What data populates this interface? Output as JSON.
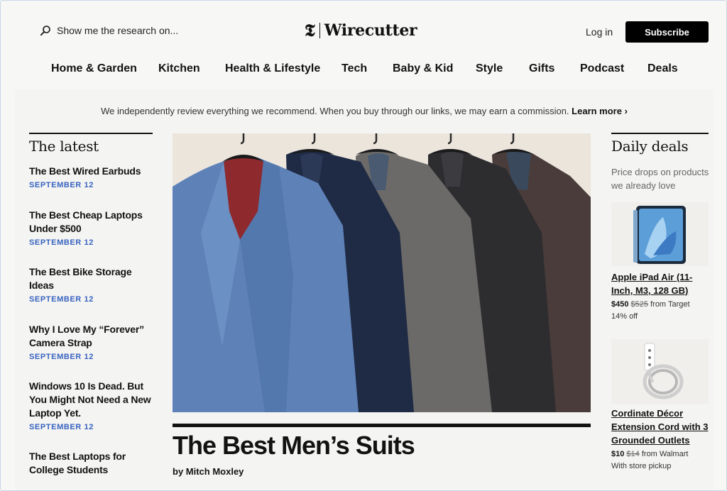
{
  "header": {
    "search_placeholder": "Show me the research on...",
    "logo_mark": "𝕿",
    "logo_text": "Wirecutter",
    "login_label": "Log in",
    "subscribe_label": "Subscribe"
  },
  "nav": [
    "Home & Garden",
    "Kitchen",
    "Health & Lifestyle",
    "Tech",
    "Baby & Kid",
    "Style",
    "Gifts",
    "Podcast",
    "Deals"
  ],
  "disclosure": {
    "text": "We independently review everything we recommend. When you buy through our links, we may earn a commission.",
    "link": "Learn more ›"
  },
  "latest": {
    "title": "The latest",
    "items": [
      {
        "title": "The Best Wired Earbuds",
        "date": "SEPTEMBER 12"
      },
      {
        "title": "The Best Cheap Laptops Under $500",
        "date": "SEPTEMBER 12"
      },
      {
        "title": "The Best Bike Storage Ideas",
        "date": "SEPTEMBER 12"
      },
      {
        "title": "Why I Love My “Forever” Camera Strap",
        "date": "SEPTEMBER 12"
      },
      {
        "title": "Windows 10 Is Dead. But You Might Not Need a New Laptop Yet.",
        "date": "SEPTEMBER 12"
      },
      {
        "title": "The Best Laptops for College Students",
        "date": ""
      }
    ]
  },
  "hero": {
    "title": "The Best Men’s Suits",
    "byline": "by Mitch Moxley"
  },
  "deals": {
    "title": "Daily deals",
    "subtitle": "Price drops on products we already love",
    "items": [
      {
        "title": "Apple iPad Air (11-Inch, M3, 128 GB)",
        "price": "$450",
        "old_price": "$525",
        "retailer": "from Target",
        "note": "14% off"
      },
      {
        "title": "Cordinate Décor Extension Cord with 3 Grounded Outlets",
        "price": "$10",
        "old_price": "$14",
        "retailer": "from Walmart",
        "note": "With store pickup"
      }
    ]
  },
  "colors": {
    "accent_date": "#3863c0",
    "subscribe_bg": "#000000"
  }
}
